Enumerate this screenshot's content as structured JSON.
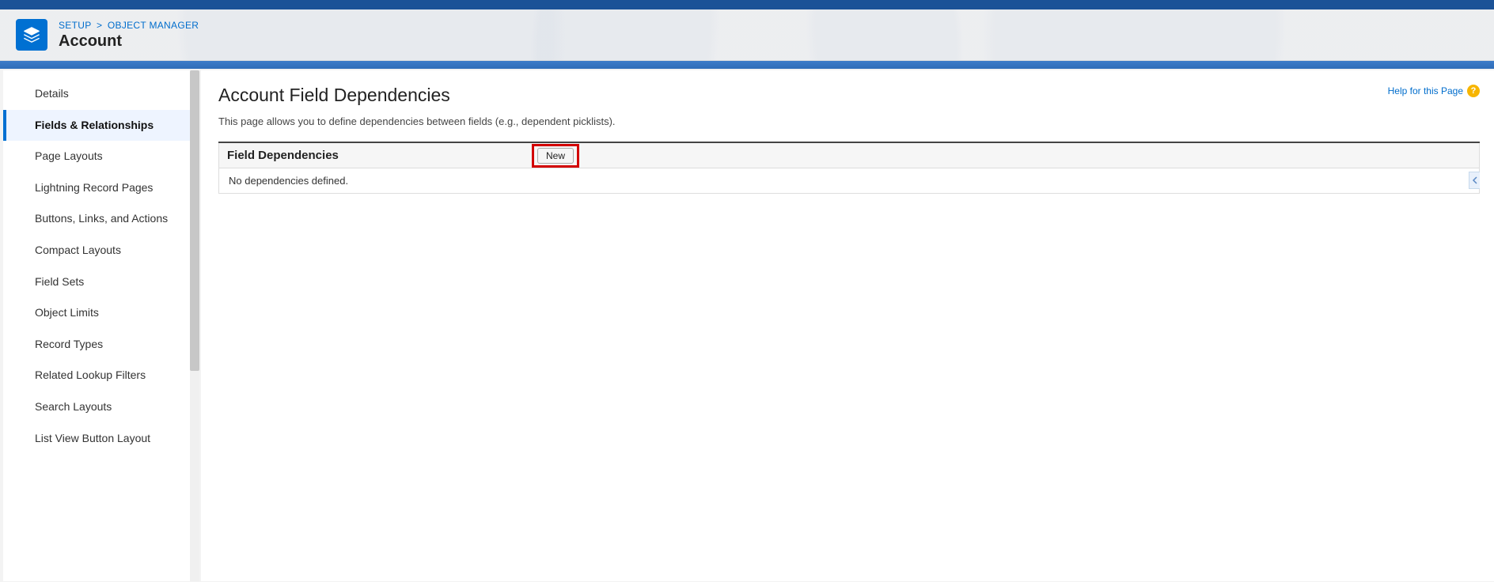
{
  "header": {
    "breadcrumb": {
      "setup": "SETUP",
      "objectManager": "OBJECT MANAGER"
    },
    "objectTitle": "Account"
  },
  "sidebar": {
    "items": [
      {
        "label": "Details"
      },
      {
        "label": "Fields & Relationships"
      },
      {
        "label": "Page Layouts"
      },
      {
        "label": "Lightning Record Pages"
      },
      {
        "label": "Buttons, Links, and Actions"
      },
      {
        "label": "Compact Layouts"
      },
      {
        "label": "Field Sets"
      },
      {
        "label": "Object Limits"
      },
      {
        "label": "Record Types"
      },
      {
        "label": "Related Lookup Filters"
      },
      {
        "label": "Search Layouts"
      },
      {
        "label": "List View Button Layout"
      }
    ],
    "activeIndex": 1
  },
  "main": {
    "pageTitle": "Account Field Dependencies",
    "description": "This page allows you to define dependencies between fields (e.g., dependent picklists).",
    "helpLink": "Help for this Page",
    "section": {
      "title": "Field Dependencies",
      "newButton": "New",
      "emptyMessage": "No dependencies defined."
    }
  },
  "icons": {
    "layers": "layers-icon",
    "help": "?"
  }
}
